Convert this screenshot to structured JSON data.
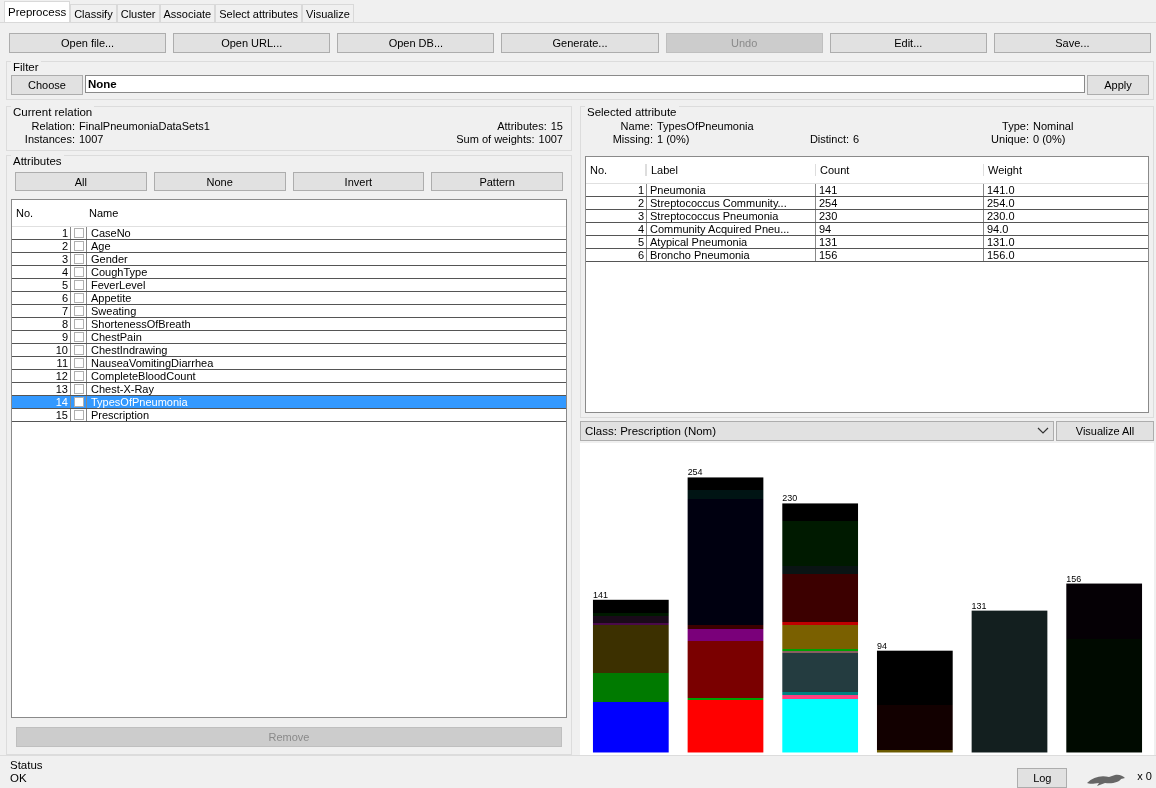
{
  "tabs": [
    {
      "label": "Preprocess",
      "selected": true
    },
    {
      "label": "Classify",
      "selected": false
    },
    {
      "label": "Cluster",
      "selected": false
    },
    {
      "label": "Associate",
      "selected": false
    },
    {
      "label": "Select attributes",
      "selected": false
    },
    {
      "label": "Visualize",
      "selected": false
    }
  ],
  "toolbar": [
    {
      "label": "Open file...",
      "disabled": false
    },
    {
      "label": "Open URL...",
      "disabled": false
    },
    {
      "label": "Open DB...",
      "disabled": false
    },
    {
      "label": "Generate...",
      "disabled": false
    },
    {
      "label": "Undo",
      "disabled": true
    },
    {
      "label": "Edit...",
      "disabled": false
    },
    {
      "label": "Save...",
      "disabled": false
    }
  ],
  "filter": {
    "title": "Filter",
    "choose": "Choose",
    "value": "None",
    "apply": "Apply"
  },
  "current_relation": {
    "title": "Current relation",
    "relation_label": "Relation:",
    "relation": "FinalPneumoniaDataSets1",
    "instances_label": "Instances:",
    "instances": "1007",
    "attributes_label": "Attributes:",
    "attributes": "15",
    "weights_label": "Sum of weights:",
    "weights": "1007"
  },
  "attributes": {
    "title": "Attributes",
    "buttons": [
      "All",
      "None",
      "Invert",
      "Pattern"
    ],
    "columns": [
      "No.",
      "Name"
    ],
    "rows": [
      {
        "no": "1",
        "name": "CaseNo",
        "checked": false,
        "selected": false
      },
      {
        "no": "2",
        "name": "Age",
        "checked": false,
        "selected": false
      },
      {
        "no": "3",
        "name": "Gender",
        "checked": false,
        "selected": false
      },
      {
        "no": "4",
        "name": "CoughType",
        "checked": false,
        "selected": false
      },
      {
        "no": "5",
        "name": "FeverLevel",
        "checked": false,
        "selected": false
      },
      {
        "no": "6",
        "name": "Appetite",
        "checked": false,
        "selected": false
      },
      {
        "no": "7",
        "name": "Sweating",
        "checked": false,
        "selected": false
      },
      {
        "no": "8",
        "name": "ShortenessOfBreath",
        "checked": false,
        "selected": false
      },
      {
        "no": "9",
        "name": "ChestPain",
        "checked": false,
        "selected": false
      },
      {
        "no": "10",
        "name": "ChestIndrawing",
        "checked": false,
        "selected": false
      },
      {
        "no": "11",
        "name": "NauseaVomitingDiarrhea",
        "checked": false,
        "selected": false
      },
      {
        "no": "12",
        "name": "CompleteBloodCount",
        "checked": false,
        "selected": false
      },
      {
        "no": "13",
        "name": "Chest-X-Ray",
        "checked": false,
        "selected": false
      },
      {
        "no": "14",
        "name": "TypesOfPneumonia",
        "checked": false,
        "selected": true
      },
      {
        "no": "15",
        "name": "Prescription",
        "checked": false,
        "selected": false
      }
    ],
    "remove": {
      "label": "Remove",
      "disabled": true
    }
  },
  "selected_attribute": {
    "title": "Selected attribute",
    "name_label": "Name:",
    "name": "TypesOfPneumonia",
    "type_label": "Type:",
    "type": "Nominal",
    "missing_label": "Missing:",
    "missing": "1 (0%)",
    "distinct_label": "Distinct:",
    "distinct": "6",
    "unique_label": "Unique:",
    "unique": "0 (0%)",
    "columns": [
      "No.",
      "Label",
      "Count",
      "Weight"
    ],
    "rows": [
      {
        "no": "1",
        "label": "Pneumonia",
        "count": "141",
        "weight": "141.0"
      },
      {
        "no": "2",
        "label": "Streptococcus Community...",
        "count": "254",
        "weight": "254.0"
      },
      {
        "no": "3",
        "label": "Streptococcus Pneumonia",
        "count": "230",
        "weight": "230.0"
      },
      {
        "no": "4",
        "label": "Community Acquired Pneu...",
        "count": "94",
        "weight": "94.0"
      },
      {
        "no": "5",
        "label": "Atypical Pneumonia",
        "count": "131",
        "weight": "131.0"
      },
      {
        "no": "6",
        "label": "Broncho Pneumonia",
        "count": "156",
        "weight": "156.0"
      }
    ]
  },
  "class_select": {
    "value": "Class: Prescription (Nom)",
    "visualize_all": "Visualize All"
  },
  "histogram": {
    "bars": [
      {
        "count": "141"
      },
      {
        "count": "254"
      },
      {
        "count": "230"
      },
      {
        "count": "94"
      },
      {
        "count": "131"
      },
      {
        "count": "156"
      }
    ]
  },
  "status": {
    "title": "Status",
    "message": "OK",
    "log": "Log",
    "count": "x 0"
  }
}
